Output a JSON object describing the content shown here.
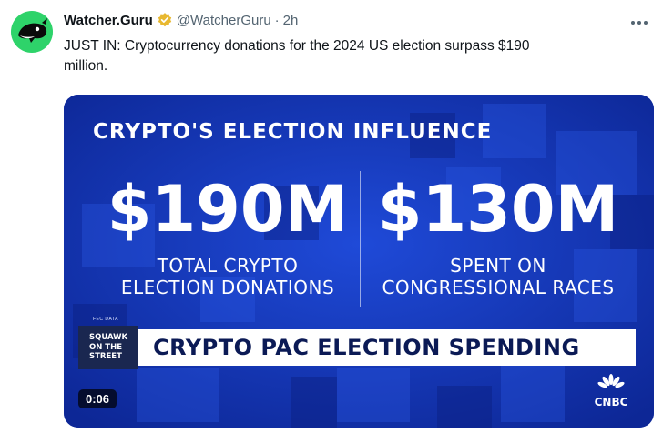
{
  "tweet": {
    "author_name": "Watcher.Guru",
    "handle": "@WatcherGuru",
    "separator": "·",
    "time": "2h",
    "more_icon": "more-dots-icon",
    "text_line1": "JUST IN: Cryptocurrency donations for the 2024 US election surpass $190",
    "text_line2": "million."
  },
  "media": {
    "headline": "CRYPTO'S ELECTION INFLUENCE",
    "stat1_value": "$190M",
    "stat1_line1": "TOTAL CRYPTO",
    "stat1_line2": "ELECTION DONATIONS",
    "stat2_value": "$130M",
    "stat2_line1": "SPENT ON",
    "stat2_line2": "CONGRESSIONAL RACES",
    "source": "FEC DATA",
    "show_line1": "SQUAWK",
    "show_line2": "ON THE",
    "show_line3": "STREET",
    "banner": "CRYPTO PAC ELECTION SPENDING",
    "timer": "0:06",
    "network": "CNBC"
  },
  "colors": {
    "avatar_bg": "#2ed36a",
    "verified": "#e8b830",
    "media_bg": "#1235b8",
    "banner_text": "#0b1a55"
  }
}
